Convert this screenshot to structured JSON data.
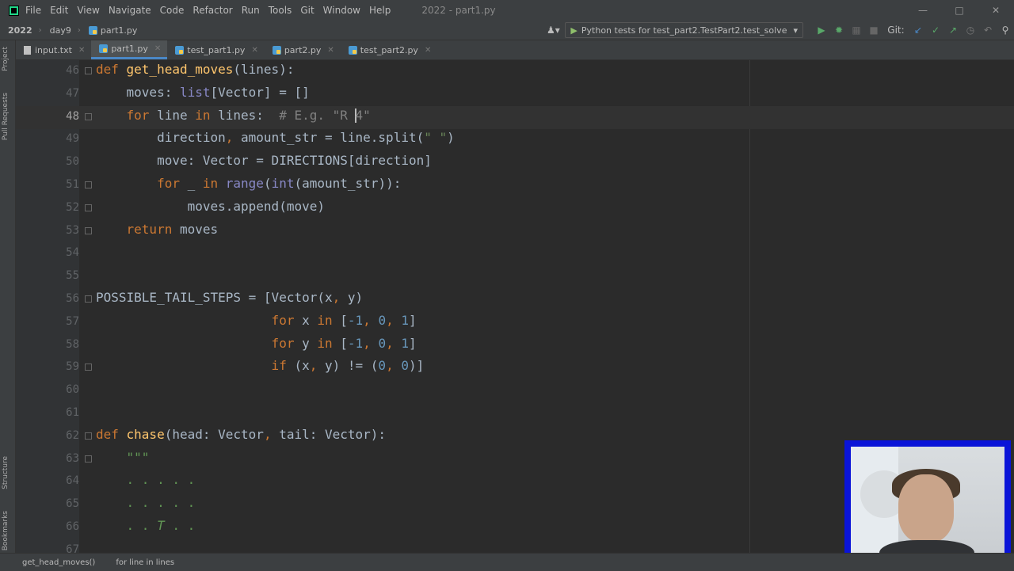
{
  "menubar": {
    "items": [
      "File",
      "Edit",
      "View",
      "Navigate",
      "Code",
      "Refactor",
      "Run",
      "Tools",
      "Git",
      "Window",
      "Help"
    ],
    "window_title": "2022 - part1.py"
  },
  "navbar": {
    "breadcrumbs": [
      "2022",
      "day9",
      "part1.py"
    ],
    "run_config": "Python tests for test_part2.TestPart2.test_solve",
    "git_label": "Git:"
  },
  "tabs": [
    {
      "label": "input.txt",
      "type": "txt",
      "active": false
    },
    {
      "label": "part1.py",
      "type": "py",
      "active": true
    },
    {
      "label": "test_part1.py",
      "type": "py",
      "active": false
    },
    {
      "label": "part2.py",
      "type": "py",
      "active": false
    },
    {
      "label": "test_part2.py",
      "type": "py",
      "active": false
    }
  ],
  "side_panels": [
    "Project",
    "Pull Requests",
    "Structure",
    "Bookmarks"
  ],
  "editor": {
    "current_line": 48,
    "lines": [
      {
        "n": 46,
        "fold": true,
        "tokens": [
          [
            "kw",
            "def "
          ],
          [
            "fn",
            "get_head_moves"
          ],
          [
            "",
            "(lines):"
          ]
        ]
      },
      {
        "n": 47,
        "fold": false,
        "tokens": [
          [
            "",
            "    moves: "
          ],
          [
            "bi",
            "list"
          ],
          [
            "",
            "[Vector] = []"
          ]
        ]
      },
      {
        "n": 48,
        "fold": true,
        "tokens": [
          [
            "kw",
            "    for "
          ],
          [
            "",
            "line "
          ],
          [
            "kw",
            "in "
          ],
          [
            "",
            "lines:  "
          ],
          [
            "cm",
            "# E.g. \"R "
          ],
          [
            "caret",
            ""
          ],
          [
            "cm",
            "4\""
          ]
        ]
      },
      {
        "n": 49,
        "fold": false,
        "tokens": [
          [
            "",
            "        direction"
          ],
          [
            "kw",
            ", "
          ],
          [
            "",
            "amount_str = line.split("
          ],
          [
            "str",
            "\" \""
          ],
          [
            "",
            ")"
          ]
        ]
      },
      {
        "n": 50,
        "fold": false,
        "tokens": [
          [
            "",
            "        move: Vector = DIRECTIONS[direction]"
          ]
        ]
      },
      {
        "n": 51,
        "fold": true,
        "tokens": [
          [
            "kw",
            "        for "
          ],
          [
            "",
            "_ "
          ],
          [
            "kw",
            "in "
          ],
          [
            "bi",
            "range"
          ],
          [
            "",
            "("
          ],
          [
            "bi",
            "int"
          ],
          [
            "",
            "(amount_str)):"
          ]
        ]
      },
      {
        "n": 52,
        "fold": true,
        "tokens": [
          [
            "",
            "            moves.append(move)"
          ]
        ]
      },
      {
        "n": 53,
        "fold": true,
        "tokens": [
          [
            "kw",
            "    return "
          ],
          [
            "",
            "moves"
          ]
        ]
      },
      {
        "n": 54,
        "fold": false,
        "tokens": []
      },
      {
        "n": 55,
        "fold": false,
        "tokens": []
      },
      {
        "n": 56,
        "fold": true,
        "tokens": [
          [
            "",
            "POSSIBLE_TAIL_STEPS = [Vector(x"
          ],
          [
            "kw",
            ", "
          ],
          [
            "",
            "y)"
          ]
        ]
      },
      {
        "n": 57,
        "fold": false,
        "tokens": [
          [
            "kw",
            "                       for "
          ],
          [
            "",
            "x "
          ],
          [
            "kw",
            "in "
          ],
          [
            "",
            "["
          ],
          [
            "num",
            "-1"
          ],
          [
            "kw",
            ", "
          ],
          [
            "num",
            "0"
          ],
          [
            "kw",
            ", "
          ],
          [
            "num",
            "1"
          ],
          [
            "",
            "]"
          ]
        ]
      },
      {
        "n": 58,
        "fold": false,
        "tokens": [
          [
            "kw",
            "                       for "
          ],
          [
            "",
            "y "
          ],
          [
            "kw",
            "in "
          ],
          [
            "",
            "["
          ],
          [
            "num",
            "-1"
          ],
          [
            "kw",
            ", "
          ],
          [
            "num",
            "0"
          ],
          [
            "kw",
            ", "
          ],
          [
            "num",
            "1"
          ],
          [
            "",
            "]"
          ]
        ]
      },
      {
        "n": 59,
        "fold": true,
        "tokens": [
          [
            "kw",
            "                       if "
          ],
          [
            "",
            "(x"
          ],
          [
            "kw",
            ", "
          ],
          [
            "",
            "y) != ("
          ],
          [
            "num",
            "0"
          ],
          [
            "kw",
            ", "
          ],
          [
            "num",
            "0"
          ],
          [
            "",
            ")]"
          ]
        ]
      },
      {
        "n": 60,
        "fold": false,
        "tokens": []
      },
      {
        "n": 61,
        "fold": false,
        "tokens": []
      },
      {
        "n": 62,
        "fold": true,
        "tokens": [
          [
            "kw",
            "def "
          ],
          [
            "fn",
            "chase"
          ],
          [
            "",
            "(head: Vector"
          ],
          [
            "kw",
            ", "
          ],
          [
            "",
            "tail: Vector):"
          ]
        ]
      },
      {
        "n": 63,
        "fold": true,
        "tokens": [
          [
            "doc",
            "    \"\"\""
          ]
        ]
      },
      {
        "n": 64,
        "fold": false,
        "tokens": [
          [
            "doc",
            "    . . . . ."
          ]
        ]
      },
      {
        "n": 65,
        "fold": false,
        "tokens": [
          [
            "doc",
            "    . . . . ."
          ]
        ]
      },
      {
        "n": 66,
        "fold": false,
        "tokens": [
          [
            "doc",
            "    . . "
          ],
          [
            "doc-i",
            "T"
          ],
          [
            "doc",
            " . ."
          ]
        ]
      },
      {
        "n": 67,
        "fold": false,
        "tokens": []
      }
    ]
  },
  "statusbar": {
    "crumb1": "get_head_moves()",
    "crumb2": "for line in lines"
  }
}
